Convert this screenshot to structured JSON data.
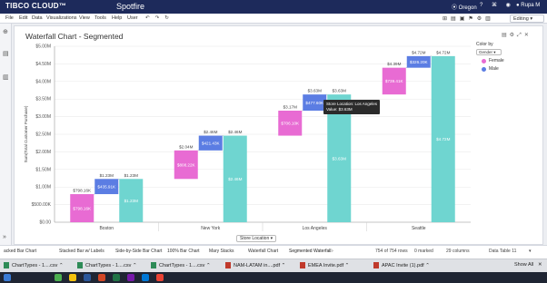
{
  "app": {
    "brand": "TIBCO CLOUD™",
    "product": "Spotfire",
    "region": "Oregon",
    "user": "Rupa M",
    "mode": "Editing",
    "menu": [
      "File",
      "Edit",
      "Data",
      "Visualizations",
      "View",
      "Tools",
      "Help",
      "User"
    ]
  },
  "chart_panel": {
    "title": "Waterfall Chart - Segmented",
    "color_by_label": "Color by",
    "color_by_value": "Gender",
    "x_axis_selector": "Store Location",
    "tooltip_line1": "Store Location: Los Angeles",
    "tooltip_line2": "Value: $3.63M"
  },
  "chart_data": {
    "type": "bar",
    "subtype": "waterfall-segmented",
    "title": "Waterfall Chart - Segmented",
    "ylabel": "Sum(Total Customer Purchase)",
    "xlabel": "Store Location",
    "ylim": [
      0,
      5000000
    ],
    "yticks": [
      "$0.00",
      "$500.00K",
      "$1.00M",
      "$1.50M",
      "$2.00M",
      "$2.50M",
      "$3.00M",
      "$3.50M",
      "$4.00M",
      "$4.50M",
      "$5.00M"
    ],
    "legend": [
      {
        "name": "Female",
        "color": "#e86bd3"
      },
      {
        "name": "Male",
        "color": "#5b7de3"
      }
    ],
    "total_color": "#6fd5d0",
    "groups": [
      {
        "category": "Boston",
        "steps": [
          {
            "series": "Female",
            "start": 0,
            "end": 798160,
            "label": "$798.16K",
            "top_label": "$798.16K"
          },
          {
            "series": "Male",
            "start": 798160,
            "end": 1230000,
            "label": "$435.91K",
            "top_label": "$1.23M"
          },
          {
            "series": "Total",
            "start": 0,
            "end": 1230000,
            "label": "$1.23M",
            "top_label": "$1.23M"
          }
        ]
      },
      {
        "category": "New York",
        "steps": [
          {
            "series": "Female",
            "start": 1230000,
            "end": 2040000,
            "label": "$808.22K",
            "top_label": "$2.04M"
          },
          {
            "series": "Male",
            "start": 2040000,
            "end": 2460000,
            "label": "$421.43K",
            "top_label": "$2.46M"
          },
          {
            "series": "Total",
            "start": 0,
            "end": 2460000,
            "label": "$2.46M",
            "top_label": "$2.46M"
          }
        ]
      },
      {
        "category": "Los Angeles",
        "steps": [
          {
            "series": "Female",
            "start": 2460000,
            "end": 3170000,
            "label": "$706.10K",
            "top_label": "$3.17M"
          },
          {
            "series": "Male",
            "start": 3170000,
            "end": 3630000,
            "label": "$477.60K",
            "top_label": "$3.63M"
          },
          {
            "series": "Total",
            "start": 0,
            "end": 3630000,
            "label": "$3.63M",
            "top_label": "$3.63M"
          }
        ]
      },
      {
        "category": "Seattle",
        "steps": [
          {
            "series": "Female",
            "start": 3630000,
            "end": 4390000,
            "label": "$739.41K",
            "top_label": "$4.39M"
          },
          {
            "series": "Male",
            "start": 4390000,
            "end": 4720000,
            "label": "$326.20K",
            "top_label": "$4.72M"
          },
          {
            "series": "Total",
            "start": 0,
            "end": 4720000,
            "label": "$4.72M",
            "top_label": "$4.72M"
          }
        ]
      }
    ]
  },
  "tabs": [
    "acked Bar Chart",
    "Stacked Bar w/ Labels",
    "Side-by-Side Bar Chart",
    "100% Bar Chart",
    "Mary Stacks",
    "Waterfall Chart",
    "Segmented Waterfall"
  ],
  "status": {
    "rows": "754 of 754 rows",
    "marked": "0 marked",
    "columns": "29 columns",
    "table": "Data Table 11"
  },
  "downloads": {
    "items": [
      "ChartTypes - 1....csv",
      "ChartTypes - 1....csv",
      "ChartTypes - 1....csv",
      "NAM-LATAM in....pdf",
      "EMEA Invite.pdf",
      "APAC Invite (1).pdf"
    ],
    "show_all": "Show All"
  }
}
